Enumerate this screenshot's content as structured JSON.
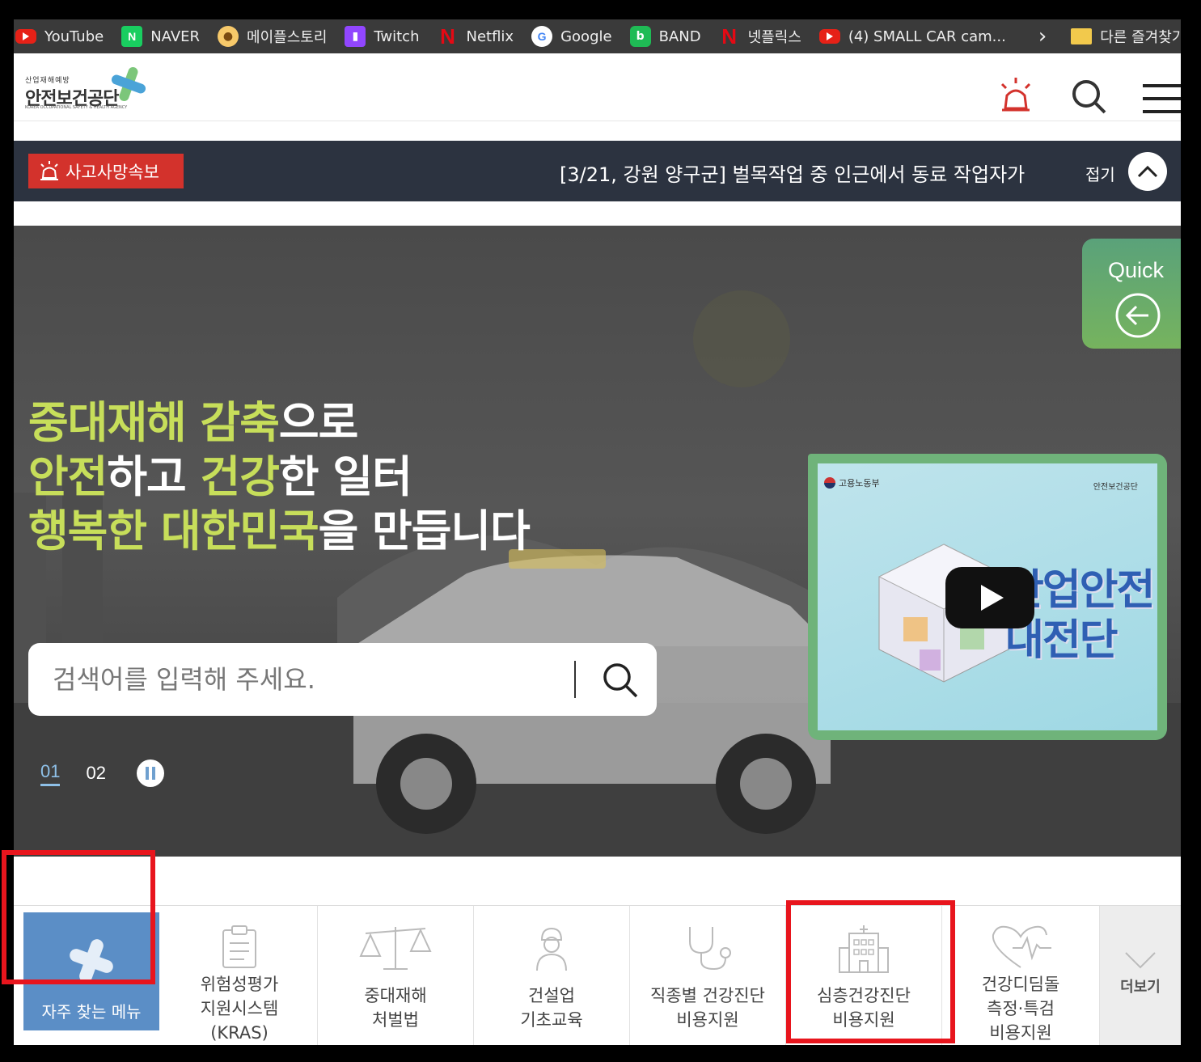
{
  "bookmarks": [
    {
      "label": "YouTube",
      "icon": "youtube-icon"
    },
    {
      "label": "NAVER",
      "icon": "naver-icon"
    },
    {
      "label": "메이플스토리",
      "icon": "maplestory-icon"
    },
    {
      "label": "Twitch",
      "icon": "twitch-icon"
    },
    {
      "label": "Netflix",
      "icon": "netflix-icon"
    },
    {
      "label": "Google",
      "icon": "google-icon"
    },
    {
      "label": "BAND",
      "icon": "band-icon"
    },
    {
      "label": "넷플릭스",
      "icon": "netflix-icon"
    },
    {
      "label": "(4) SMALL CAR cam...",
      "icon": "youtube-icon"
    }
  ],
  "other_bookmarks": "다른 즐겨찾기",
  "header": {
    "logo_small": "산업재해예방",
    "logo_main": "안전보건공단",
    "logo_eng": "KOREA OCCUPATIONAL SAFETY & HEALTH AGENCY"
  },
  "alert": {
    "tag": "사고사망속보",
    "text": "[3/21, 강원 양구군] 벌목작업 중 인근에서 동료 작업자가",
    "fold_label": "접기"
  },
  "hero": {
    "line1": {
      "g1": "중대재해 감축",
      "w1": "으로"
    },
    "line2": {
      "g1": "안전",
      "w1": "하고 ",
      "g2": "건강",
      "w2": "한 일터"
    },
    "line3": {
      "g1": "행복한 대한민국",
      "w1": "을 만듭니다"
    },
    "quick_label": "Quick",
    "video": {
      "ministry": "고용노동부",
      "agency": "안전보건공단",
      "title_line1": "산업안전",
      "title_line2": "대전단"
    },
    "search_placeholder": "검색어를 입력해 주세요.",
    "pages": [
      "01",
      "02"
    ],
    "active_page": "01"
  },
  "quick_menu": [
    {
      "label": "자주 찾는 메뉴",
      "icon": "plus-cross-icon"
    },
    {
      "label": "위험성평가\n지원시스템\n(KRAS)",
      "icon": "clipboard-icon"
    },
    {
      "label": "중대재해\n처벌법",
      "icon": "scale-icon"
    },
    {
      "label": "건설업\n기초교육",
      "icon": "construction-worker-icon"
    },
    {
      "label": "직종별 건강진단\n비용지원",
      "icon": "stethoscope-icon"
    },
    {
      "label": "심층건강진단\n비용지원",
      "icon": "hospital-icon"
    },
    {
      "label": "건강디딤돌\n측정·특검\n비용지원",
      "icon": "heartbeat-icon"
    },
    {
      "label": "더보기",
      "icon": "chevron-down-icon"
    }
  ],
  "colors": {
    "accent_green": "#c7de5a",
    "alert_red": "#d3322c",
    "highlight_red": "#e8151d",
    "fav_blue": "#5b8ec6",
    "alert_bar": "#2c3340"
  }
}
